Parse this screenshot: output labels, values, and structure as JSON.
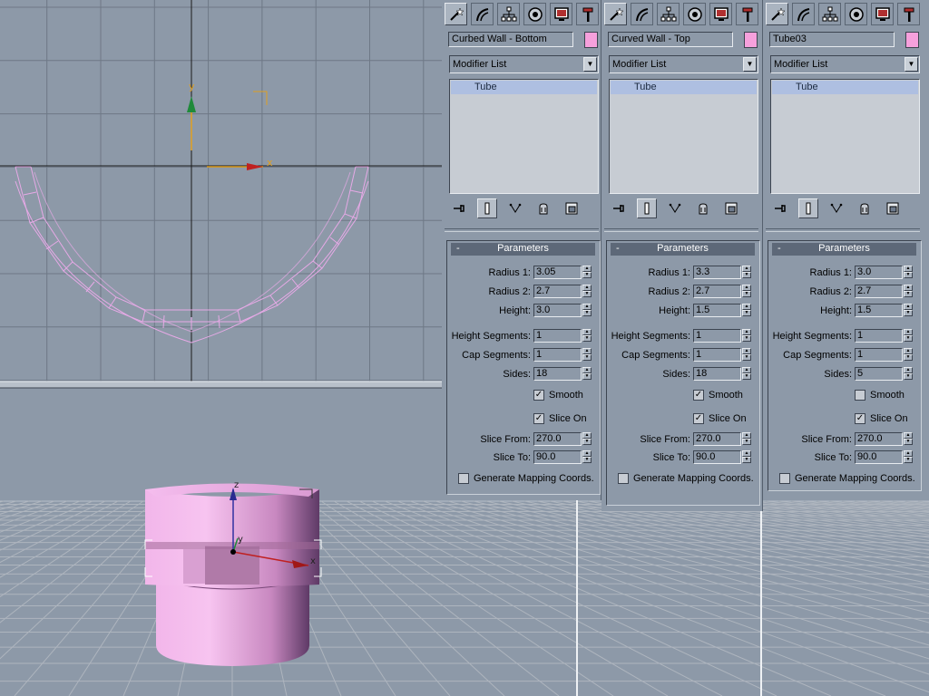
{
  "colors": {
    "selection_pink": "#f6a0dc",
    "wire_pink": "#e6a9e6",
    "viewport_bg": "#8d99a8",
    "grid": "#6e7886"
  },
  "viewports": {
    "top": {
      "axis_labels": {
        "x": "x",
        "y": "y"
      }
    },
    "perspective": {
      "axis_labels": {
        "x": "x",
        "y": "y",
        "z": "z"
      }
    }
  },
  "command_tab_icons": [
    "create-wand-icon",
    "modify-curve-icon",
    "hierarchy-icon",
    "motion-icon",
    "display-icon",
    "utilities-hammer-icon"
  ],
  "panels": [
    {
      "name": "Curbed Wall - Bottom",
      "modifier_list": "Modifier List",
      "stack_item": "Tube",
      "rollout": "Parameters",
      "collapse": "-",
      "fields": [
        {
          "label": "Radius 1:",
          "value": "3.05"
        },
        {
          "label": "Radius 2:",
          "value": "2.7"
        },
        {
          "label": "Height:",
          "value": "3.0"
        },
        {
          "label": "Height Segments:",
          "value": "1"
        },
        {
          "label": "Cap Segments:",
          "value": "1"
        },
        {
          "label": "Sides:",
          "value": "18"
        }
      ],
      "smooth": {
        "label": "Smooth",
        "checked": true
      },
      "slice_on": {
        "label": "Slice On",
        "checked": true
      },
      "slice_fields": [
        {
          "label": "Slice From:",
          "value": "270.0"
        },
        {
          "label": "Slice To:",
          "value": "90.0"
        }
      ],
      "mapping": {
        "label": "Generate Mapping Coords.",
        "checked": false
      }
    },
    {
      "name": "Curved Wall - Top",
      "modifier_list": "Modifier List",
      "stack_item": "Tube",
      "rollout": "Parameters",
      "collapse": "-",
      "fields": [
        {
          "label": "Radius 1:",
          "value": "3.3"
        },
        {
          "label": "Radius 2:",
          "value": "2.7"
        },
        {
          "label": "Height:",
          "value": "1.5"
        },
        {
          "label": "Height Segments:",
          "value": "1"
        },
        {
          "label": "Cap Segments:",
          "value": "1"
        },
        {
          "label": "Sides:",
          "value": "18"
        }
      ],
      "smooth": {
        "label": "Smooth",
        "checked": true
      },
      "slice_on": {
        "label": "Slice On",
        "checked": true
      },
      "slice_fields": [
        {
          "label": "Slice From:",
          "value": "270.0"
        },
        {
          "label": "Slice To:",
          "value": "90.0"
        }
      ],
      "mapping": {
        "label": "Generate Mapping Coords.",
        "checked": false
      }
    },
    {
      "name": "Tube03",
      "modifier_list": "Modifier List",
      "stack_item": "Tube",
      "rollout": "Parameters",
      "collapse": "-",
      "fields": [
        {
          "label": "Radius 1:",
          "value": "3.0"
        },
        {
          "label": "Radius 2:",
          "value": "2.7"
        },
        {
          "label": "Height:",
          "value": "1.5"
        },
        {
          "label": "Height Segments:",
          "value": "1"
        },
        {
          "label": "Cap Segments:",
          "value": "1"
        },
        {
          "label": "Sides:",
          "value": "5"
        }
      ],
      "smooth": {
        "label": "Smooth",
        "checked": false
      },
      "slice_on": {
        "label": "Slice On",
        "checked": true
      },
      "slice_fields": [
        {
          "label": "Slice From:",
          "value": "270.0"
        },
        {
          "label": "Slice To:",
          "value": "90.0"
        }
      ],
      "mapping": {
        "label": "Generate Mapping Coords.",
        "checked": false
      }
    }
  ]
}
